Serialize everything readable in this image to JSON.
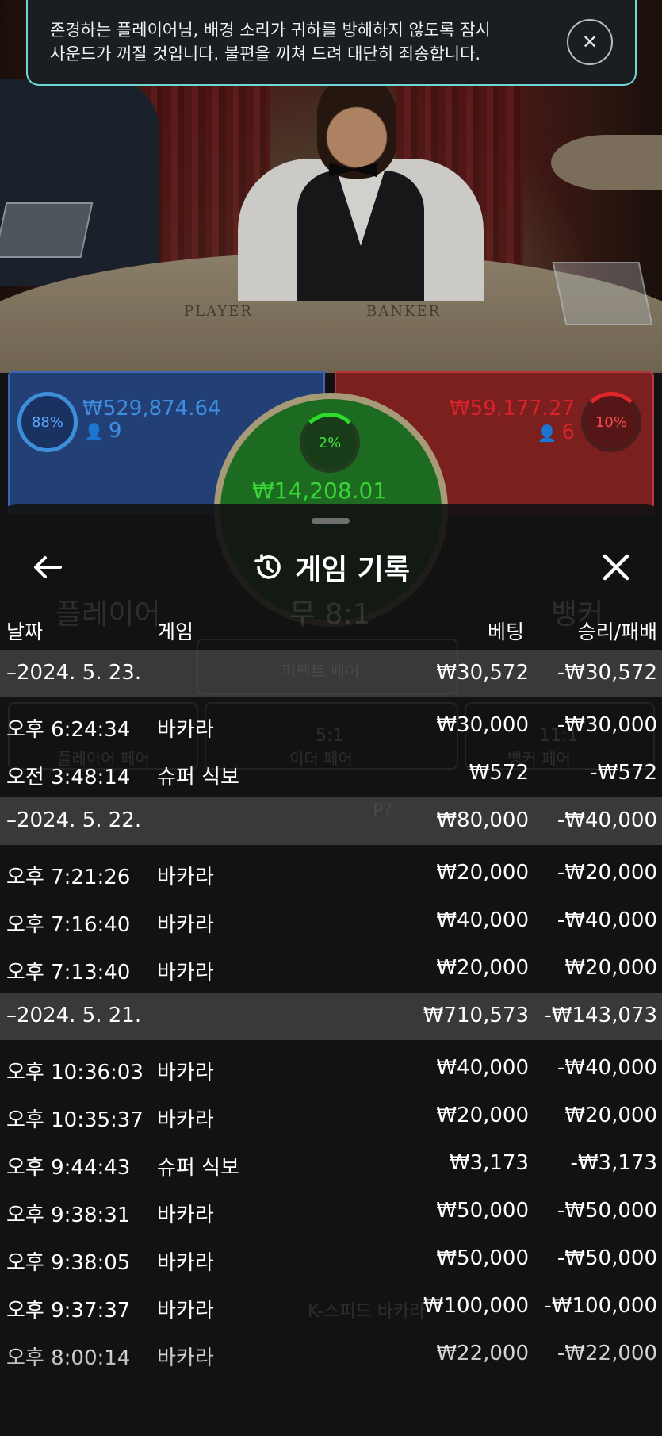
{
  "toast": {
    "message": "존경하는 플레이어님, 배경 소리가 귀하를 방해하지 않도록 잠시\n사운드가 꺼질 것입니다. 불편을 끼쳐 드려 대단히 죄송합니다.",
    "close_glyph": "✕"
  },
  "video": {
    "felt_player": "PLAYER",
    "felt_banker": "BANKER"
  },
  "betting": {
    "player": {
      "percent": "88%",
      "amount": "₩529,874.64",
      "players": "9",
      "color": "#3f8de0"
    },
    "tie": {
      "percent": "2%",
      "amount": "₩14,208.01",
      "color": "#2bdc2b"
    },
    "banker": {
      "percent": "10%",
      "amount": "₩59,177.27",
      "players": "6",
      "color": "#d9232a"
    }
  },
  "background_labels": {
    "player": "플레이어",
    "tie": "무 8:1",
    "banker": "뱅커",
    "perfect_pair": "퍼펙트 페어",
    "either_pair": "이더 페어",
    "player_pair": "플레이어 페어",
    "banker_pair": "뱅커 페어",
    "either_ratio": "5:1",
    "banker_pair_ratio": "11:1",
    "p_label": "P?",
    "footer": "K-스피드 바카라"
  },
  "panel": {
    "title": "게임 기록",
    "back_icon": "arrow-left-icon",
    "history_icon": "history-icon",
    "close_icon": "close-icon",
    "columns": {
      "date": "날짜",
      "game": "게임",
      "bet": "베팅",
      "result": "승리/패배"
    }
  },
  "history": [
    {
      "type": "group",
      "date": "–2024. 5. 23.",
      "game": "",
      "bet": "₩30,572",
      "result": "-₩30,572"
    },
    {
      "type": "item",
      "date": "오후 6:24:34",
      "game": "바카라",
      "bet": "₩30,000",
      "result": "-₩30,000"
    },
    {
      "type": "item",
      "date": "오전 3:48:14",
      "game": "슈퍼 식보",
      "bet": "₩572",
      "result": "-₩572"
    },
    {
      "type": "group",
      "date": "–2024. 5. 22.",
      "game": "",
      "bet": "₩80,000",
      "result": "-₩40,000"
    },
    {
      "type": "item",
      "date": "오후 7:21:26",
      "game": "바카라",
      "bet": "₩20,000",
      "result": "-₩20,000"
    },
    {
      "type": "item",
      "date": "오후 7:16:40",
      "game": "바카라",
      "bet": "₩40,000",
      "result": "-₩40,000"
    },
    {
      "type": "item",
      "date": "오후 7:13:40",
      "game": "바카라",
      "bet": "₩20,000",
      "result": "₩20,000"
    },
    {
      "type": "group",
      "date": "–2024. 5. 21.",
      "game": "",
      "bet": "₩710,573",
      "result": "-₩143,073"
    },
    {
      "type": "item",
      "date": "오후 10:36:03",
      "game": "바카라",
      "bet": "₩40,000",
      "result": "-₩40,000"
    },
    {
      "type": "item",
      "date": "오후 10:35:37",
      "game": "바카라",
      "bet": "₩20,000",
      "result": "₩20,000"
    },
    {
      "type": "item",
      "date": "오후 9:44:43",
      "game": "슈퍼 식보",
      "bet": "₩3,173",
      "result": "-₩3,173"
    },
    {
      "type": "item",
      "date": "오후 9:38:31",
      "game": "바카라",
      "bet": "₩50,000",
      "result": "-₩50,000"
    },
    {
      "type": "item",
      "date": "오후 9:38:05",
      "game": "바카라",
      "bet": "₩50,000",
      "result": "-₩50,000"
    },
    {
      "type": "item",
      "date": "오후 9:37:37",
      "game": "바카라",
      "bet": "₩100,000",
      "result": "-₩100,000"
    },
    {
      "type": "item",
      "date": "오후 8:00:14",
      "game": "바카라",
      "bet": "₩22,000",
      "result": "-₩22,000"
    }
  ]
}
